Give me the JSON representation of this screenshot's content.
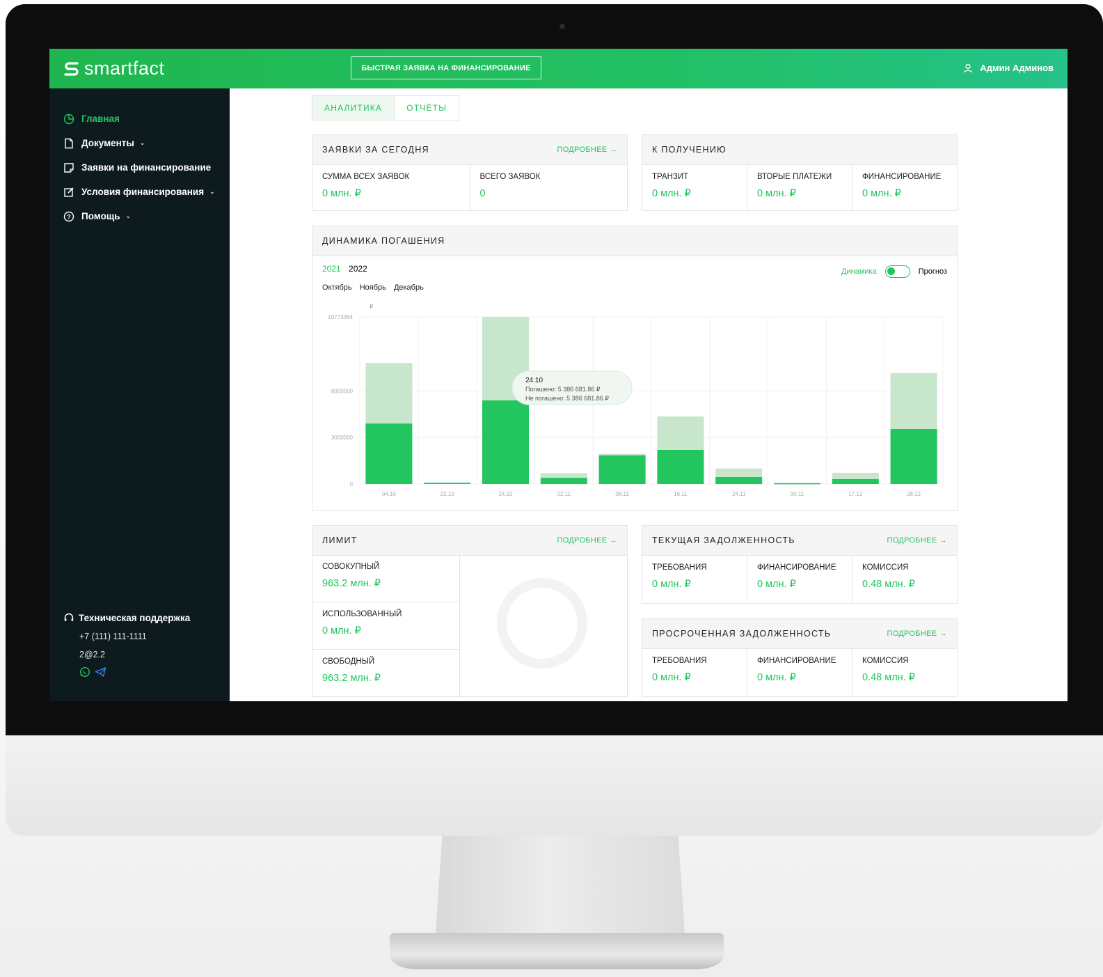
{
  "colors": {
    "accent": "#22c55e",
    "sidebar_bg": "#0d1a1e",
    "header_start": "#1fb64f",
    "header_end": "#25c28a",
    "bar_light": "#c8e6cc"
  },
  "header": {
    "logo_text": "smartfact",
    "quick_request": "БЫСТРАЯ ЗАЯВКА НА ФИНАНСИРОВАНИЕ",
    "user_name": "Админ Админов",
    "user_icon": "user-icon"
  },
  "sidebar": {
    "items": [
      {
        "label": "Главная",
        "icon": "dashboard-icon",
        "active": true
      },
      {
        "label": "Документы",
        "icon": "document-icon",
        "chevron": "⌄"
      },
      {
        "label": "Заявки на финансирование",
        "icon": "note-icon"
      },
      {
        "label": "Условия финансирования",
        "icon": "edit-icon",
        "chevron": "⌄"
      },
      {
        "label": "Помощь",
        "icon": "help-icon",
        "chevron": "⌄"
      }
    ],
    "support": {
      "title": "Техническая поддержка",
      "phone": "+7 (111) 111-1111",
      "email": "2@2.2",
      "icons": [
        "whatsapp-icon",
        "telegram-icon"
      ]
    }
  },
  "tabs": [
    "АНАЛИТИКА",
    "ОТЧЁТЫ"
  ],
  "today": {
    "title": "ЗАЯВКИ ЗА СЕГОДНЯ",
    "more": "ПОДРОБНЕЕ →",
    "cells": [
      {
        "label": "СУММА ВСЕХ ЗАЯВОК",
        "value": "0 млн. ₽"
      },
      {
        "label": "ВСЕГО ЗАЯВОК",
        "value": "0"
      }
    ]
  },
  "receive": {
    "title": "К ПОЛУЧЕНИЮ",
    "cells": [
      {
        "label": "ТРАНЗИТ",
        "value": "0 млн. ₽"
      },
      {
        "label": "ВТОРЫЕ ПЛАТЕЖИ",
        "value": "0 млн. ₽"
      },
      {
        "label": "ФИНАНСИРОВАНИЕ",
        "value": "0 млн. ₽"
      }
    ]
  },
  "dynamics": {
    "title": "ДИНАМИКА ПОГАШЕНИЯ",
    "years": [
      "2021",
      "2022"
    ],
    "months": [
      "Октябрь",
      "Ноябрь",
      "Декабрь"
    ],
    "toggle_left": "Динамика",
    "toggle_right": "Прогноз",
    "tooltip": {
      "date": "24.10",
      "paid": "Погашено: 5 386 681.86 ₽",
      "unpaid": "Не погашено: 5 386 681.86 ₽"
    }
  },
  "chart_data": {
    "type": "bar",
    "stacked": true,
    "ylabel": "₽",
    "ytick_labels": [
      "0",
      "3000000",
      "6000000",
      "10773364"
    ],
    "ylim": [
      0,
      10773364
    ],
    "categories": [
      "04.10",
      "22.10",
      "24.10",
      "02.11",
      "08.11",
      "16.11",
      "24.11",
      "30.11",
      "17.12",
      "28.12"
    ],
    "series": [
      {
        "values": [
          3900000,
          80000,
          5386682,
          400000,
          1850000,
          2200000,
          450000,
          50000,
          320000,
          3550000
        ]
      },
      {
        "values": [
          3900000,
          0,
          5386682,
          300000,
          100000,
          2150000,
          550000,
          0,
          400000,
          3600000
        ]
      }
    ],
    "colors": [
      "#22c55e",
      "#c8e6cc"
    ],
    "grid": true
  },
  "limit": {
    "title": "ЛИМИТ",
    "more": "ПОДРОБНЕЕ →",
    "cells": [
      {
        "label": "СОВОКУПНЫЙ",
        "value": "963.2 млн. ₽"
      },
      {
        "label": "ИСПОЛЬЗОВАННЫЙ",
        "value": "0 млн. ₽"
      },
      {
        "label": "СВОБОДНЫЙ",
        "value": "963.2 млн. ₽"
      }
    ]
  },
  "current_debt": {
    "title": "ТЕКУЩАЯ ЗАДОЛЖЕННОСТЬ",
    "more": "ПОДРОБНЕЕ →",
    "cells": [
      {
        "label": "ТРЕБОВАНИЯ",
        "value": "0 млн. ₽"
      },
      {
        "label": "ФИНАНСИРОВАНИЕ",
        "value": "0 млн. ₽"
      },
      {
        "label": "КОМИССИЯ",
        "value": "0.48 млн. ₽"
      }
    ]
  },
  "overdue_debt": {
    "title": "ПРОСРОЧЕННАЯ ЗАДОЛЖЕННОСТЬ",
    "more": "ПОДРОБНЕЕ →",
    "cells": [
      {
        "label": "ТРЕБОВАНИЯ",
        "value": "0 млн. ₽"
      },
      {
        "label": "ФИНАНСИРОВАНИЕ",
        "value": "0 млн. ₽"
      },
      {
        "label": "КОМИССИЯ",
        "value": "0.48 млн. ₽"
      }
    ]
  }
}
